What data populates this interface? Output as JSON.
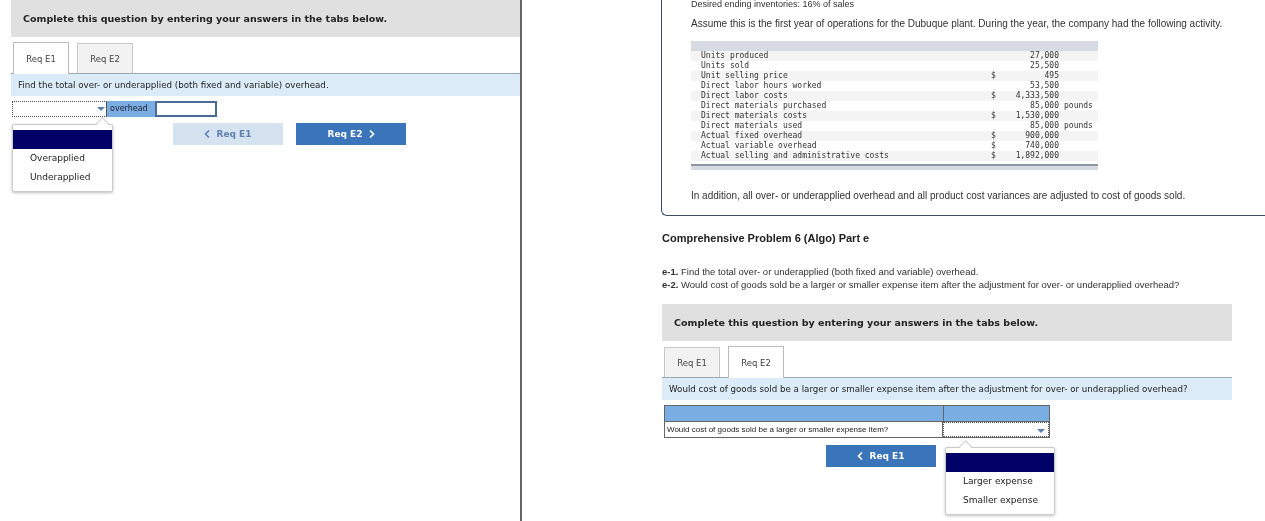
{
  "left_panel": {
    "instruction": "Complete this question by entering your answers in the tabs below.",
    "tabs": [
      {
        "label": "Req E1",
        "selected": true
      },
      {
        "label": "Req E2",
        "selected": false
      }
    ],
    "prompt": "Find the total over- or underapplied (both fixed and variable) overhead.",
    "answer_row": {
      "label": "overhead"
    },
    "dropdown": {
      "blank_highlighted": true,
      "options": [
        {
          "label": "Overapplied",
          "selected": false
        },
        {
          "label": "Underapplied",
          "selected": false
        }
      ]
    },
    "buttons": [
      {
        "label": "Req E1",
        "kind": "prev",
        "disabled": true
      },
      {
        "label": "Req E2",
        "kind": "next",
        "disabled": false
      }
    ]
  },
  "right_panel": {
    "cut_line": "Desired ending inventories: 16% of sales",
    "intro": "Assume this is the first year of operations for the Dubuque plant. During the year, the company had the following activity.",
    "data_table": {
      "rows": [
        {
          "label": "Units produced",
          "currency": "",
          "value": "27,000",
          "unit": ""
        },
        {
          "label": "Units sold",
          "currency": "",
          "value": "25,500",
          "unit": ""
        },
        {
          "label": "Unit selling price",
          "currency": "$",
          "value": "495",
          "unit": ""
        },
        {
          "label": "Direct labor hours worked",
          "currency": "",
          "value": "53,500",
          "unit": ""
        },
        {
          "label": "Direct labor costs",
          "currency": "$",
          "value": "4,333,500",
          "unit": ""
        },
        {
          "label": "Direct materials purchased",
          "currency": "",
          "value": "85,000",
          "unit": "pounds"
        },
        {
          "label": "Direct materials costs",
          "currency": "$",
          "value": "1,530,000",
          "unit": ""
        },
        {
          "label": "Direct materials used",
          "currency": "",
          "value": "85,000",
          "unit": "pounds"
        },
        {
          "label": "Actual fixed overhead",
          "currency": "$",
          "value": "900,000",
          "unit": ""
        },
        {
          "label": "Actual variable overhead",
          "currency": "$",
          "value": "740,000",
          "unit": ""
        },
        {
          "label": "Actual selling and administrative costs",
          "currency": "$",
          "value": "1,892,000",
          "unit": ""
        }
      ]
    },
    "note": "In addition, all over- or underapplied overhead and all product cost variances are adjusted to cost of goods sold.",
    "heading": "Comprehensive Problem 6 (Algo) Part e",
    "parts": [
      "**e-1.** Find the total over- or underapplied (both fixed and variable) overhead.",
      "**e-2.** Would cost of goods sold be a larger or smaller expense item after the adjustment for over- or underapplied overhead?"
    ],
    "question": {
      "instruction": "Complete this question by entering your answers in the tabs below.",
      "tabs": [
        {
          "label": "Req E1",
          "selected": false
        },
        {
          "label": "Req E2",
          "selected": true
        }
      ],
      "prompt": "Would cost of goods sold be a larger or smaller expense item after the adjustment for over- or underapplied overhead?",
      "answer_table": {
        "row_label": "Would cost of goods sold be a larger or smaller expense item?"
      },
      "dropdown": {
        "blank_highlighted": true,
        "options": [
          {
            "label": "Larger expense",
            "selected": false
          },
          {
            "label": "Smaller expense",
            "selected": false
          }
        ]
      },
      "buttons": [
        {
          "label": "Req E1",
          "kind": "prev",
          "disabled": false
        }
      ]
    }
  }
}
